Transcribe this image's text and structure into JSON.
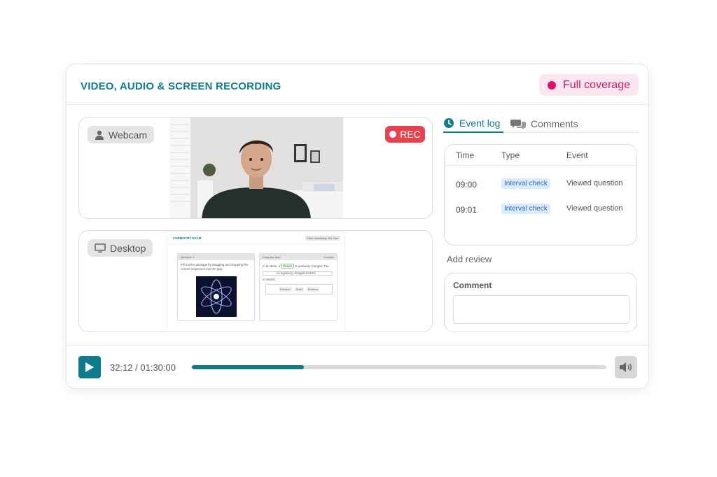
{
  "header": {
    "title": "VIDEO, AUDIO & SCREEN RECORDING",
    "coverage_label": "Full coverage"
  },
  "webcam": {
    "label": "Webcam",
    "icon": "person-icon",
    "rec_label": "REC"
  },
  "desktop": {
    "label": "Desktop",
    "icon": "monitor-icon",
    "screen": {
      "exam_title": "CHEMISTRY EXAM",
      "time_remaining": "Time remaining: 1hr 15m",
      "question_label": "Question 1",
      "question_text": "Fill out the passage by dragging and dropping the correct responses into the gap.",
      "dnd_label": "Drag and drop",
      "marks": "3 marks",
      "passage_1": "In an atom, a",
      "chip_filled": "Proton",
      "passage_2": "is positively charged. The",
      "passage_3": "is negatively charged and the",
      "passage_4": "is neutral.",
      "options": [
        "Electron",
        "Shell",
        "Neutron"
      ]
    }
  },
  "tabs": [
    {
      "label": "Event log",
      "icon": "clock-icon"
    },
    {
      "label": "Comments",
      "icon": "chat-icon"
    }
  ],
  "event_log": {
    "columns": [
      "Time",
      "Type",
      "Event"
    ],
    "rows": [
      {
        "time": "09:00",
        "type": "Interval check",
        "event": "Viewed question"
      },
      {
        "time": "09:01",
        "type": "Interval check",
        "event": "Viewed question"
      }
    ]
  },
  "review": {
    "title": "Add review",
    "comment_label": "Comment",
    "comment_value": ""
  },
  "player": {
    "time": "32:12 / 01:30:00",
    "progress": 0.27
  },
  "colors": {
    "accent": "#0e7c8c",
    "rec": "#e8424f",
    "coverage": "#e0116a"
  }
}
